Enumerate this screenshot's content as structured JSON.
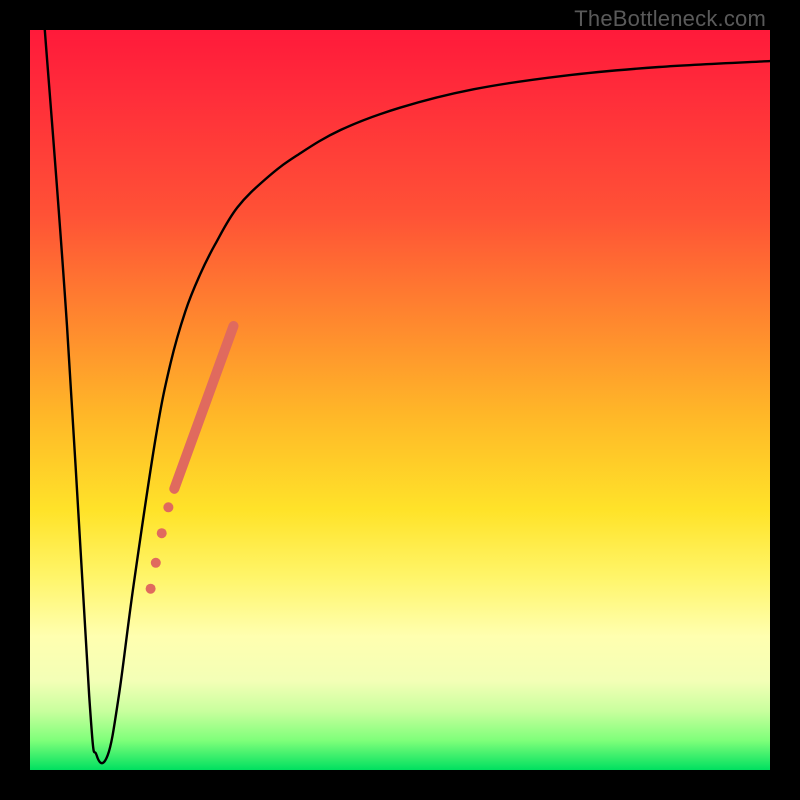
{
  "watermark": "TheBottleneck.com",
  "chart_data": {
    "type": "line",
    "title": "",
    "xlabel": "",
    "ylabel": "",
    "xlim": [
      0,
      100
    ],
    "ylim": [
      0,
      100
    ],
    "grid": false,
    "legend": false,
    "series": [
      {
        "name": "curve",
        "type": "line",
        "color": "#000000",
        "x": [
          2,
          5,
          8,
          9,
          10.5,
          12,
          14,
          17,
          19,
          21,
          23,
          25,
          28,
          32,
          36,
          42,
          50,
          60,
          72,
          85,
          100
        ],
        "y": [
          100,
          60,
          10,
          2,
          2,
          10,
          25,
          45,
          55,
          62,
          67,
          71,
          76,
          80,
          83,
          86.5,
          89.5,
          92,
          93.8,
          95,
          95.8
        ]
      },
      {
        "name": "highlight-segment",
        "type": "line",
        "color": "#e06a5e",
        "width": 10,
        "x": [
          19.5,
          27.5
        ],
        "y": [
          38,
          60
        ]
      },
      {
        "name": "highlight-dots",
        "type": "scatter",
        "color": "#e06a5e",
        "r": 5,
        "points": [
          {
            "x": 18.7,
            "y": 35.5
          },
          {
            "x": 17.8,
            "y": 32
          },
          {
            "x": 17.0,
            "y": 28
          },
          {
            "x": 16.3,
            "y": 24.5
          }
        ]
      }
    ]
  }
}
